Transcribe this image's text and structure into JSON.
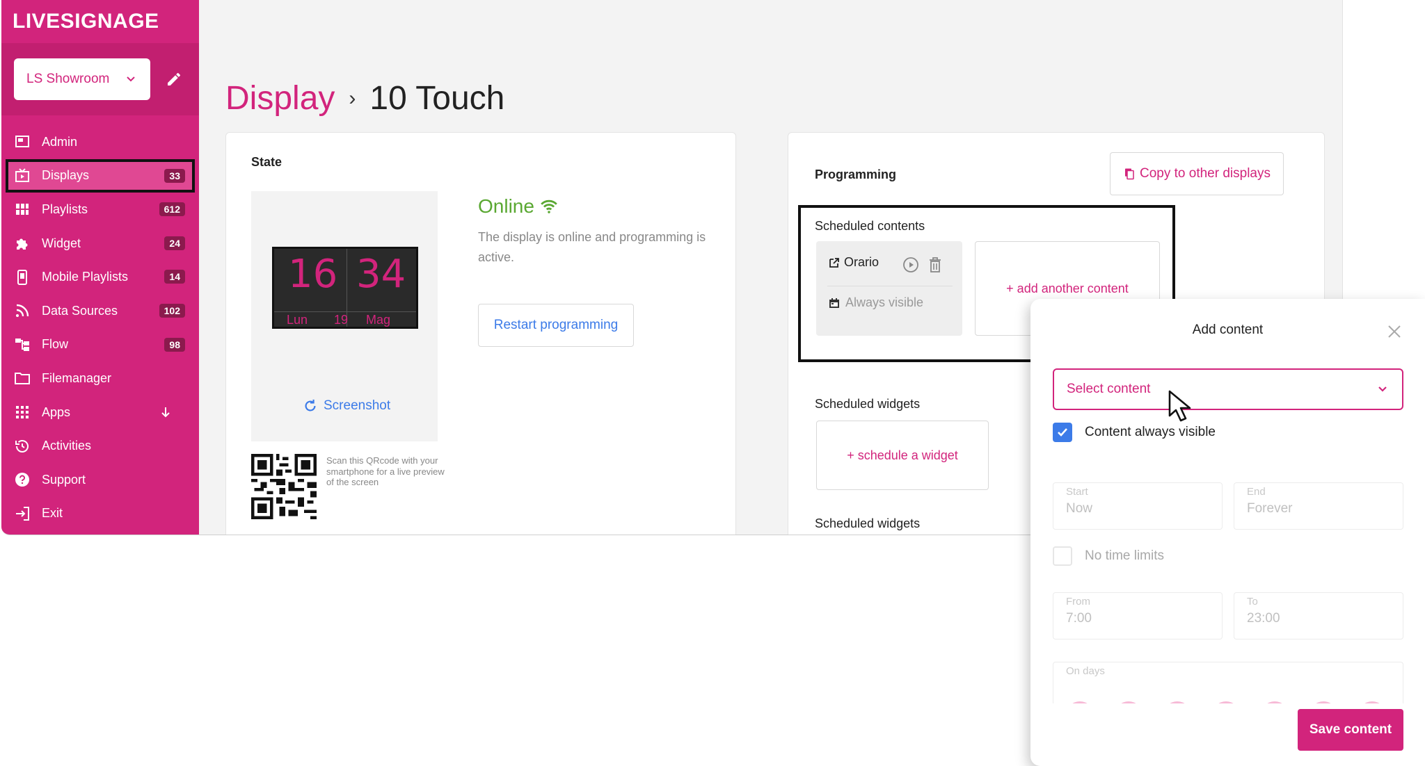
{
  "sidebar": {
    "logo": "LIVESIGNAGE",
    "tenant": "LS Showroom",
    "items": [
      {
        "label": "Admin",
        "badge": null
      },
      {
        "label": "Displays",
        "badge": "33"
      },
      {
        "label": "Playlists",
        "badge": "612"
      },
      {
        "label": "Widget",
        "badge": "24"
      },
      {
        "label": "Mobile Playlists",
        "badge": "14"
      },
      {
        "label": "Data Sources",
        "badge": "102"
      },
      {
        "label": "Flow",
        "badge": "98"
      },
      {
        "label": "Filemanager",
        "badge": null
      },
      {
        "label": "Apps",
        "badge": null
      },
      {
        "label": "Activities",
        "badge": null
      },
      {
        "label": "Support",
        "badge": null
      },
      {
        "label": "Exit",
        "badge": null
      }
    ]
  },
  "breadcrumb": {
    "section": "Display",
    "separator": "›",
    "page": "10 Touch"
  },
  "state": {
    "title": "State",
    "clock": {
      "hours": "16",
      "minutes": "34",
      "day": "Lun",
      "date": "19",
      "month": "Mag"
    },
    "screenshot_label": "Screenshot",
    "qr_text": "Scan this QRcode with your smartphone for a live preview of the screen",
    "status": "Online",
    "status_desc": "The display is online and programming is active.",
    "restart_label": "Restart programming",
    "status_color": "#5aa832"
  },
  "programming": {
    "title": "Programming",
    "copy_label": "Copy to other displays",
    "scheduled_contents_label": "Scheduled contents",
    "content_item": {
      "name": "Orario",
      "visibility": "Always visible"
    },
    "add_content_label": "+ add another content",
    "scheduled_widgets_label": "Scheduled widgets",
    "schedule_widget_label": "+ schedule a widget",
    "scheduled_widgets_label_2": "Scheduled widgets"
  },
  "modal": {
    "title": "Add content",
    "select_placeholder": "Select content",
    "always_visible_label": "Content always visible",
    "always_visible_checked": true,
    "start_label": "Start",
    "start_value": "Now",
    "end_label": "End",
    "end_value": "Forever",
    "no_time_limits_label": "No time limits",
    "no_time_limits_checked": false,
    "from_label": "From",
    "from_value": "7:00",
    "to_label": "To",
    "to_value": "23:00",
    "days_label": "On days",
    "save_label": "Save content"
  },
  "colors": {
    "brand": "#d2247c",
    "link": "#3c7be8",
    "checkbox": "#3c7be8"
  }
}
